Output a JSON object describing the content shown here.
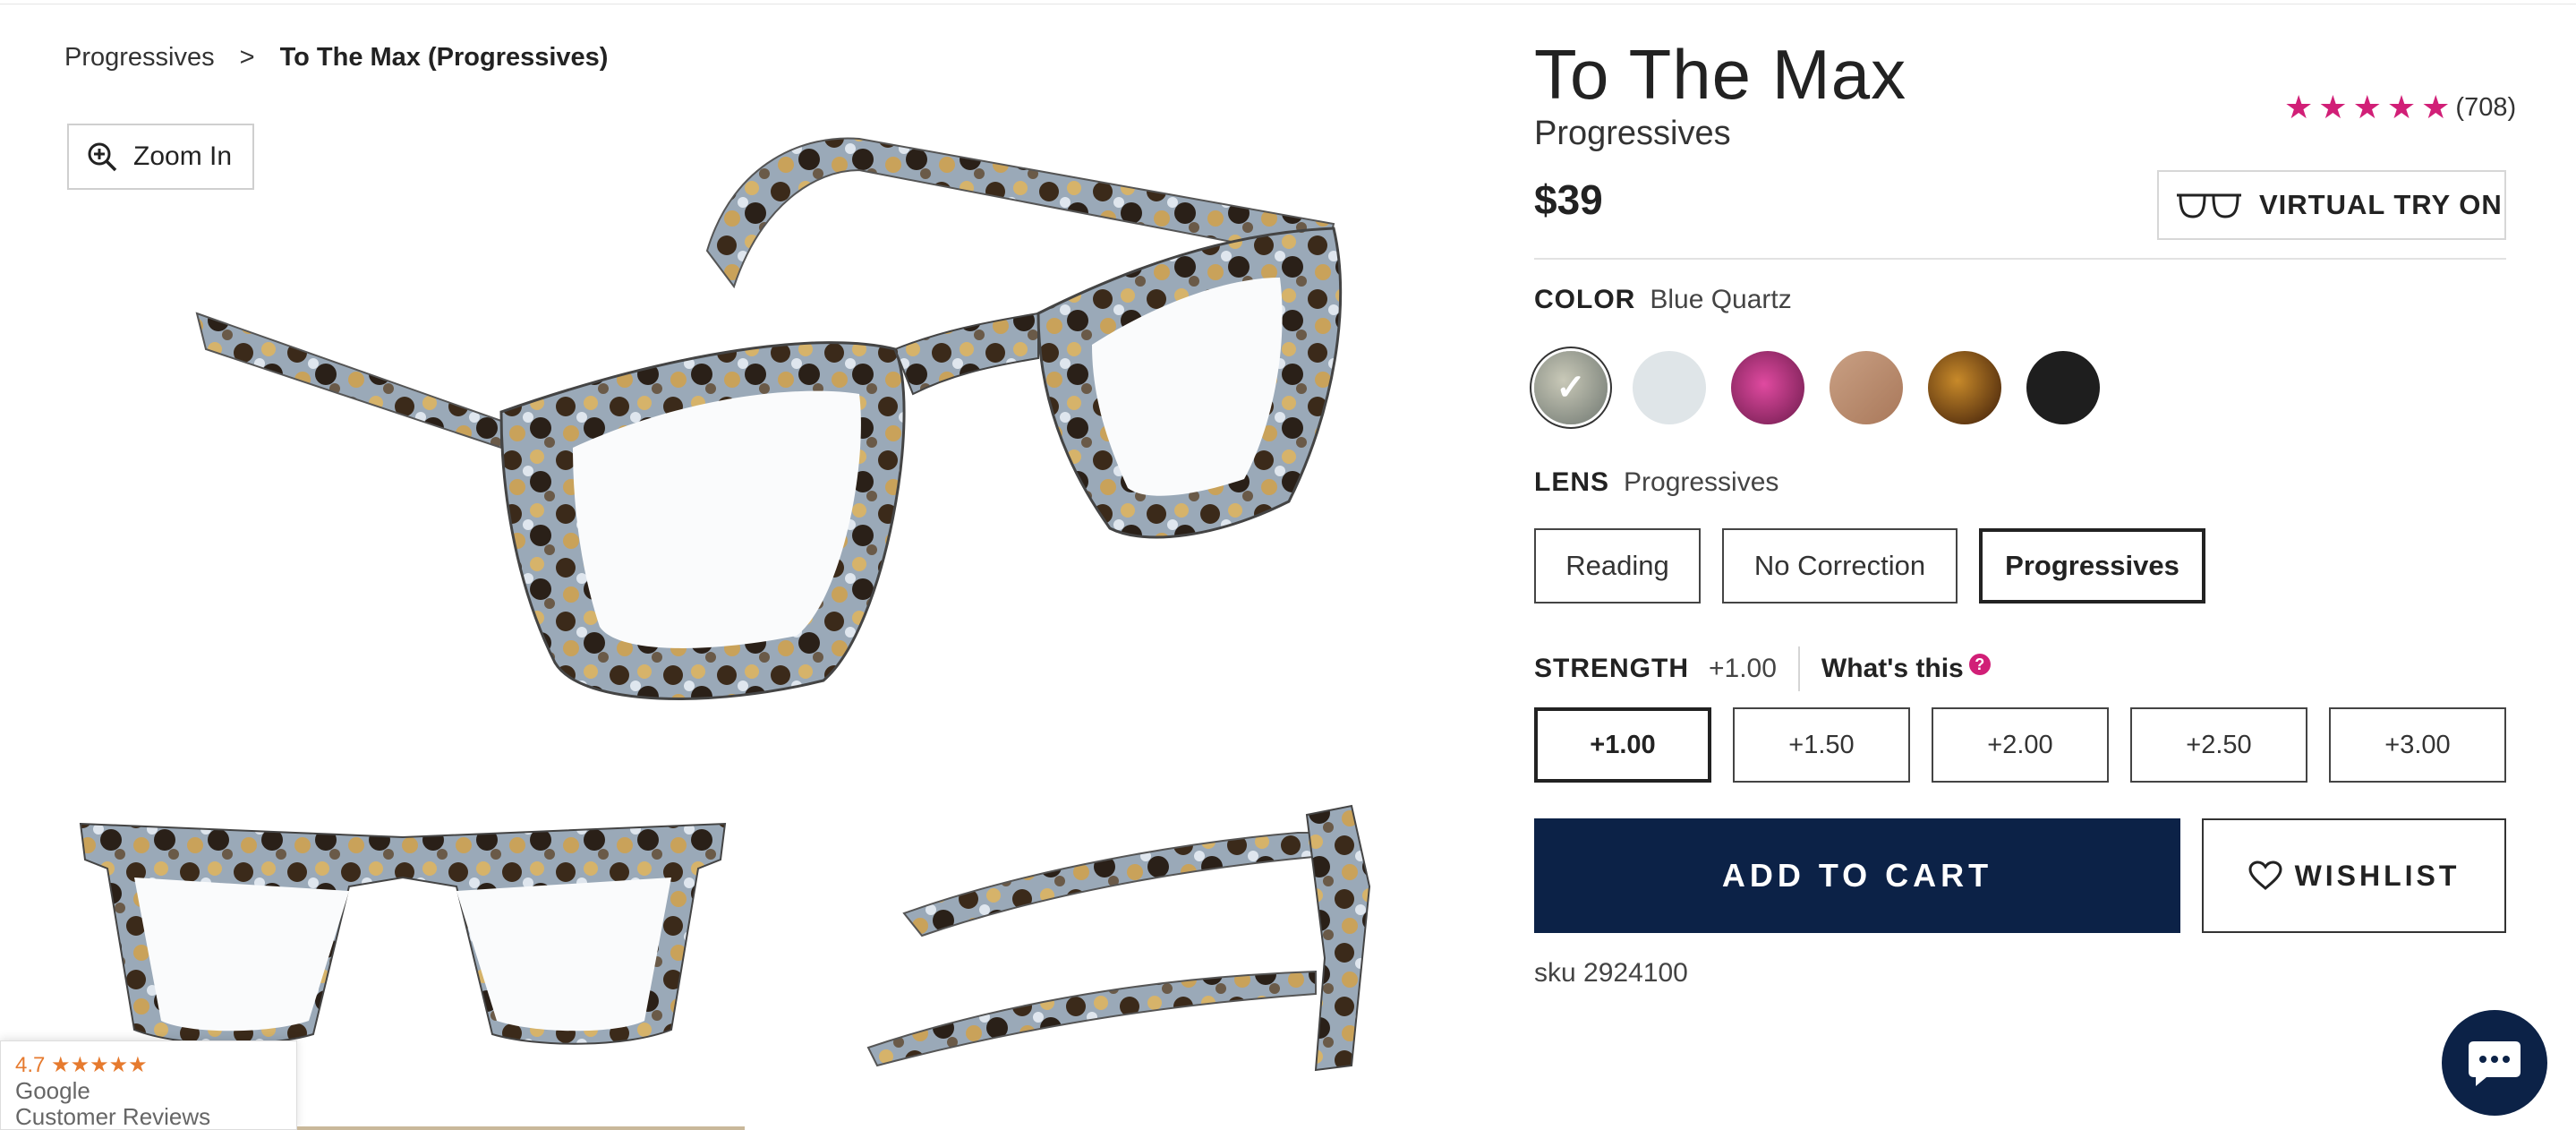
{
  "breadcrumb": {
    "parent": "Progressives",
    "separator": ">",
    "current": "To The Max (Progressives)"
  },
  "gallery": {
    "zoom_label": "Zoom In"
  },
  "product": {
    "title": "To The Max",
    "subtitle": "Progressives",
    "price": "$39",
    "rating_stars": 5,
    "review_count": "(708)",
    "virtual_try_on": "VIRTUAL TRY ON",
    "sku": "sku 2924100"
  },
  "color": {
    "label": "COLOR",
    "selected": "Blue Quartz",
    "swatches": [
      {
        "color": "#8a8f8c",
        "selected": true
      },
      {
        "color": "#dde3e6"
      },
      {
        "color": "#b0367f"
      },
      {
        "color": "#b8886a"
      },
      {
        "color": "#6a3812"
      },
      {
        "color": "#1e1e1e"
      }
    ]
  },
  "lens": {
    "label": "LENS",
    "selected": "Progressives",
    "options": [
      "Reading",
      "No Correction",
      "Progressives"
    ]
  },
  "strength": {
    "label": "STRENGTH",
    "selected": "+1.00",
    "help": "What's this",
    "help_icon": "?",
    "options": [
      "+1.00",
      "+1.50",
      "+2.00",
      "+2.50",
      "+3.00"
    ]
  },
  "actions": {
    "add_to_cart": "ADD TO CART",
    "wishlist": "WISHLIST"
  },
  "google_badge": {
    "rating": "4.7",
    "stars": "★★★★★",
    "line1": "Google",
    "line2": "Customer Reviews"
  },
  "colors": {
    "accent": "#d11f77",
    "navy": "#0c2247"
  }
}
